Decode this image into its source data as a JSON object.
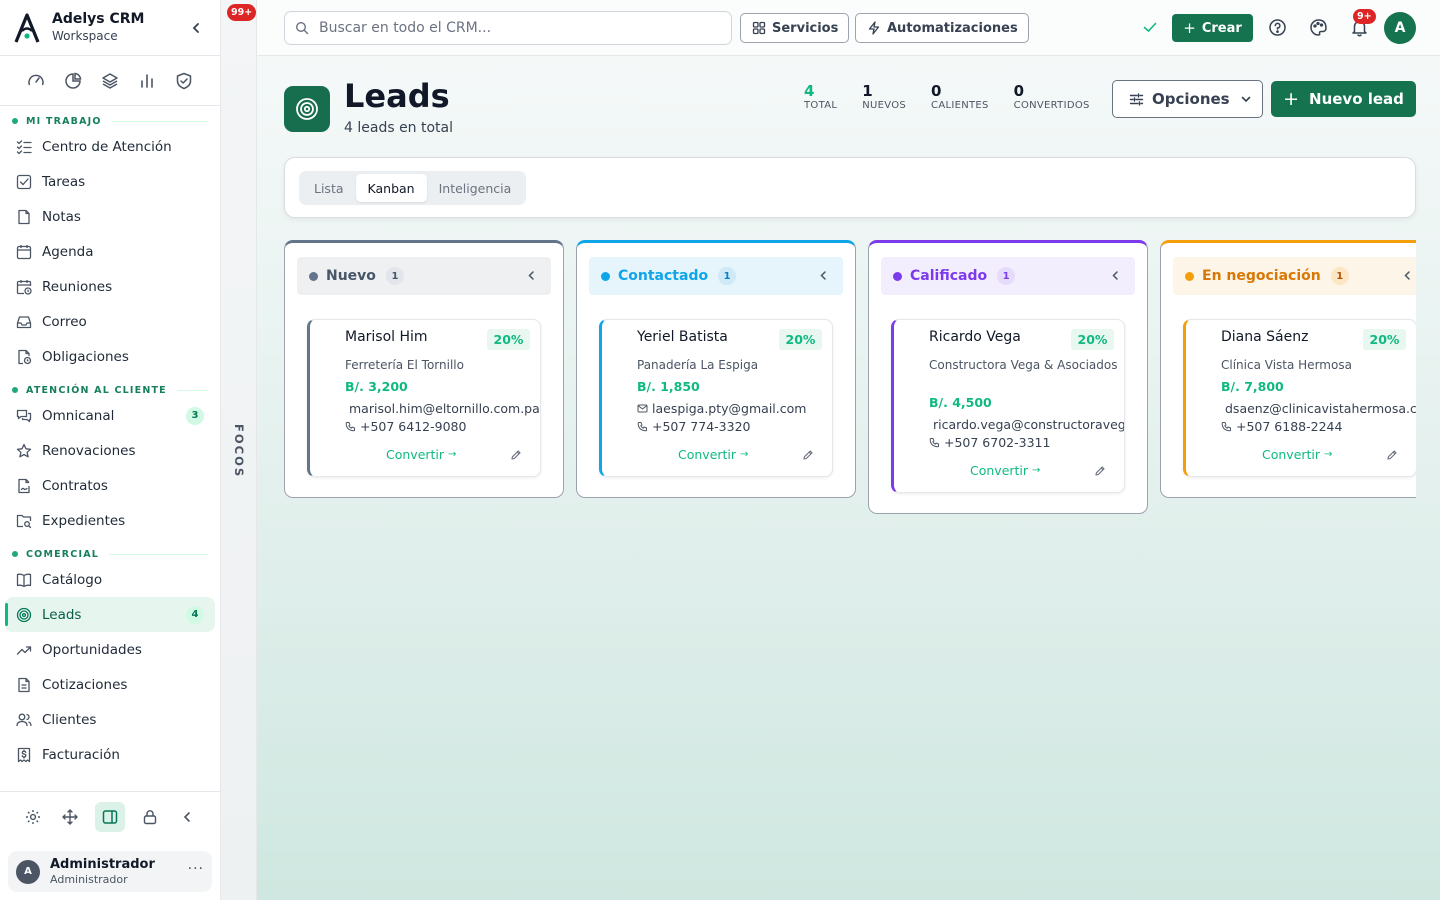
{
  "sidebar": {
    "brand": "Adelys CRM",
    "workspace": "Workspace",
    "quick_icons": [
      "gauge-icon",
      "pie-chart-icon",
      "layers-icon",
      "bar-chart-icon",
      "shield-check-icon"
    ],
    "sections": [
      {
        "title": "MI TRABAJO",
        "items": [
          {
            "label": "Centro de Atención",
            "icon": "list-check-icon"
          },
          {
            "label": "Tareas",
            "icon": "checkbox-icon"
          },
          {
            "label": "Notas",
            "icon": "file-icon"
          },
          {
            "label": "Agenda",
            "icon": "calendar-icon"
          },
          {
            "label": "Reuniones",
            "icon": "calendar-clock-icon"
          },
          {
            "label": "Correo",
            "icon": "inbox-icon"
          },
          {
            "label": "Obligaciones",
            "icon": "file-clock-icon"
          }
        ]
      },
      {
        "title": "ATENCIÓN AL CLIENTE",
        "items": [
          {
            "label": "Omnicanal",
            "icon": "messages-icon",
            "badge": "3"
          },
          {
            "label": "Renovaciones",
            "icon": "star-icon"
          },
          {
            "label": "Contratos",
            "icon": "file-signature-icon"
          },
          {
            "label": "Expedientes",
            "icon": "folder-search-icon"
          }
        ]
      },
      {
        "title": "COMERCIAL",
        "items": [
          {
            "label": "Catálogo",
            "icon": "book-icon"
          },
          {
            "label": "Leads",
            "icon": "target-icon",
            "badge": "4",
            "active": true
          },
          {
            "label": "Oportunidades",
            "icon": "trending-up-icon"
          },
          {
            "label": "Cotizaciones",
            "icon": "file-text-icon"
          },
          {
            "label": "Clientes",
            "icon": "users-icon"
          },
          {
            "label": "Facturación",
            "icon": "receipt-icon"
          }
        ]
      }
    ],
    "user": {
      "initial": "A",
      "name": "Administrador",
      "role": "Administrador",
      "more": "···"
    }
  },
  "focus": {
    "badge": "99+",
    "label": "FOCOS"
  },
  "topbar": {
    "search_placeholder": "Buscar en todo el CRM...",
    "services_label": "Servicios",
    "automations_label": "Automatizaciones",
    "create_label": "Crear",
    "notifications_badge": "9+",
    "avatar_initial": "A"
  },
  "page": {
    "title": "Leads",
    "subtitle": "4 leads en total",
    "stats": [
      {
        "value": "4",
        "label": "TOTAL"
      },
      {
        "value": "1",
        "label": "NUEVOS"
      },
      {
        "value": "0",
        "label": "CALIENTES"
      },
      {
        "value": "0",
        "label": "CONVERTIDOS"
      }
    ],
    "options_label": "Opciones",
    "new_lead_label": "Nuevo lead"
  },
  "view_tabs": [
    "Lista",
    "Kanban",
    "Inteligencia"
  ],
  "active_view": "Kanban",
  "kanban": {
    "columns": [
      {
        "title": "Nuevo",
        "count": "1",
        "color": "#64748b",
        "head_bg": "#eef0f2",
        "count_bg": "#e2e5e9",
        "count_color": "#475569",
        "cards": [
          {
            "name": "Marisol Him",
            "probability": "20%",
            "company": "Ferretería El Tornillo",
            "amount": "B/. 3,200",
            "email": "marisol.him@eltornillo.com.pa",
            "phone": "+507 6412-9080",
            "convert_label": "Convertir"
          }
        ]
      },
      {
        "title": "Contactado",
        "count": "1",
        "color": "#0ea5e9",
        "head_bg": "#e6f4fb",
        "count_bg": "#cfe9f7",
        "count_color": "#0284c7",
        "cards": [
          {
            "name": "Yeriel Batista",
            "probability": "20%",
            "company": "Panadería La Espiga",
            "amount": "B/. 1,850",
            "email": "laespiga.pty@gmail.com",
            "phone": "+507 774-3320",
            "convert_label": "Convertir"
          }
        ]
      },
      {
        "title": "Calificado",
        "count": "1",
        "color": "#7c3aed",
        "head_bg": "#f3eefd",
        "count_bg": "#e6dbfb",
        "count_color": "#7c3aed",
        "cards": [
          {
            "name": "Ricardo Vega",
            "probability": "20%",
            "company": "Constructora Vega & Asociados",
            "amount": "B/. 4,500",
            "email": "ricardo.vega@constructoravega.com",
            "phone": "+507 6702-3311",
            "convert_label": "Convertir"
          }
        ]
      },
      {
        "title": "En negociación",
        "count": "1",
        "color": "#f59e0b",
        "head_bg": "#fdf5e8",
        "count_bg": "#fbe7c4",
        "count_color": "#b45309",
        "cards": [
          {
            "name": "Diana Sáenz",
            "probability": "20%",
            "company": "Clínica Vista Hermosa",
            "amount": "B/. 7,800",
            "email": "dsaenz@clinicavistahermosa.com",
            "phone": "+507 6188-2244",
            "convert_label": "Convertir"
          }
        ]
      }
    ]
  }
}
